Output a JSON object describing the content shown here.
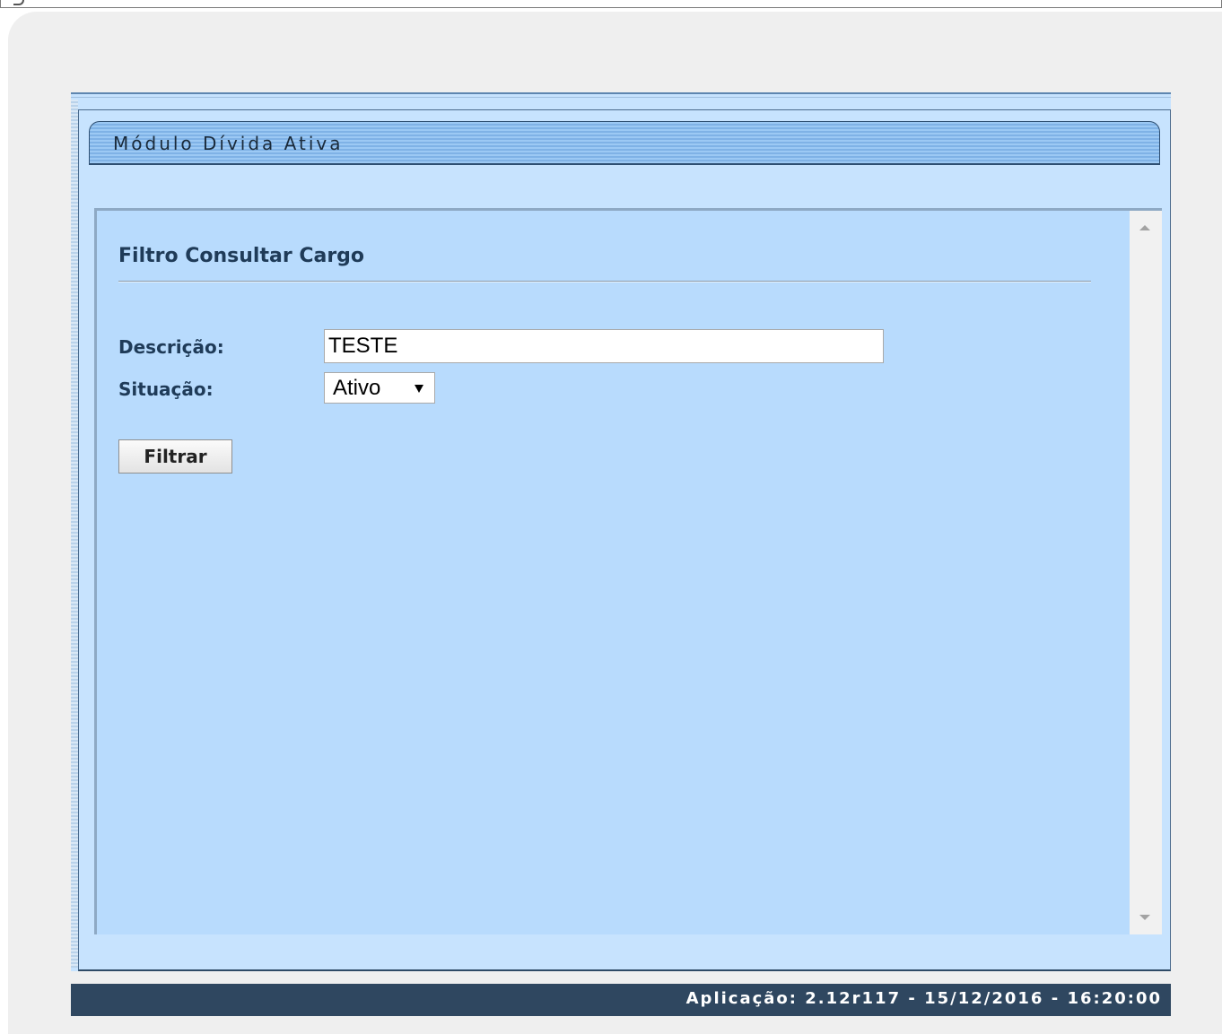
{
  "module": {
    "title": "Módulo Dívida Ativa"
  },
  "filter": {
    "title": "Filtro Consultar Cargo",
    "descricao_label": "Descrição:",
    "descricao_value": "TESTE",
    "situacao_label": "Situação:",
    "situacao_value": "Ativo",
    "submit_label": "Filtrar"
  },
  "status": {
    "text": "Aplicação: 2.12r117 - 15/12/2016 - 16:20:00"
  },
  "colors": {
    "panel_background": "#b8dbfd",
    "status_bar": "#2f4760",
    "heading_text": "#1f3b58"
  },
  "icons": {
    "scroll_up": "scroll-up-arrow-icon",
    "scroll_down": "scroll-down-arrow-icon",
    "dropdown": "dropdown-arrow-icon"
  }
}
